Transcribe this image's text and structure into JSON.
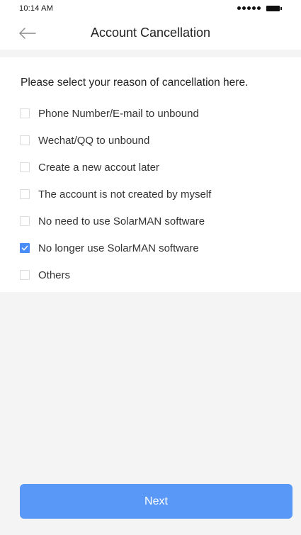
{
  "status_bar": {
    "time": "10:14 AM",
    "signal_icon": "signal-dots-icon",
    "battery_icon": "battery-icon"
  },
  "header": {
    "back_icon": "arrow-left-icon",
    "title": "Account Cancellation"
  },
  "form": {
    "prompt": "Please select your reason of cancellation here.",
    "reasons": [
      {
        "label": "Phone Number/E-mail to unbound",
        "checked": false
      },
      {
        "label": "Wechat/QQ to unbound",
        "checked": false
      },
      {
        "label": "Create a new accout later",
        "checked": false
      },
      {
        "label": "The account is not created by myself",
        "checked": false
      },
      {
        "label": "No need to use SolarMAN software",
        "checked": false
      },
      {
        "label": "No longer use SolarMAN software",
        "checked": true
      },
      {
        "label": "Others",
        "checked": false
      }
    ]
  },
  "footer": {
    "next_label": "Next"
  },
  "colors": {
    "accent": "#4b8df8",
    "button": "#5a98f7",
    "background_gray": "#f4f4f4"
  }
}
